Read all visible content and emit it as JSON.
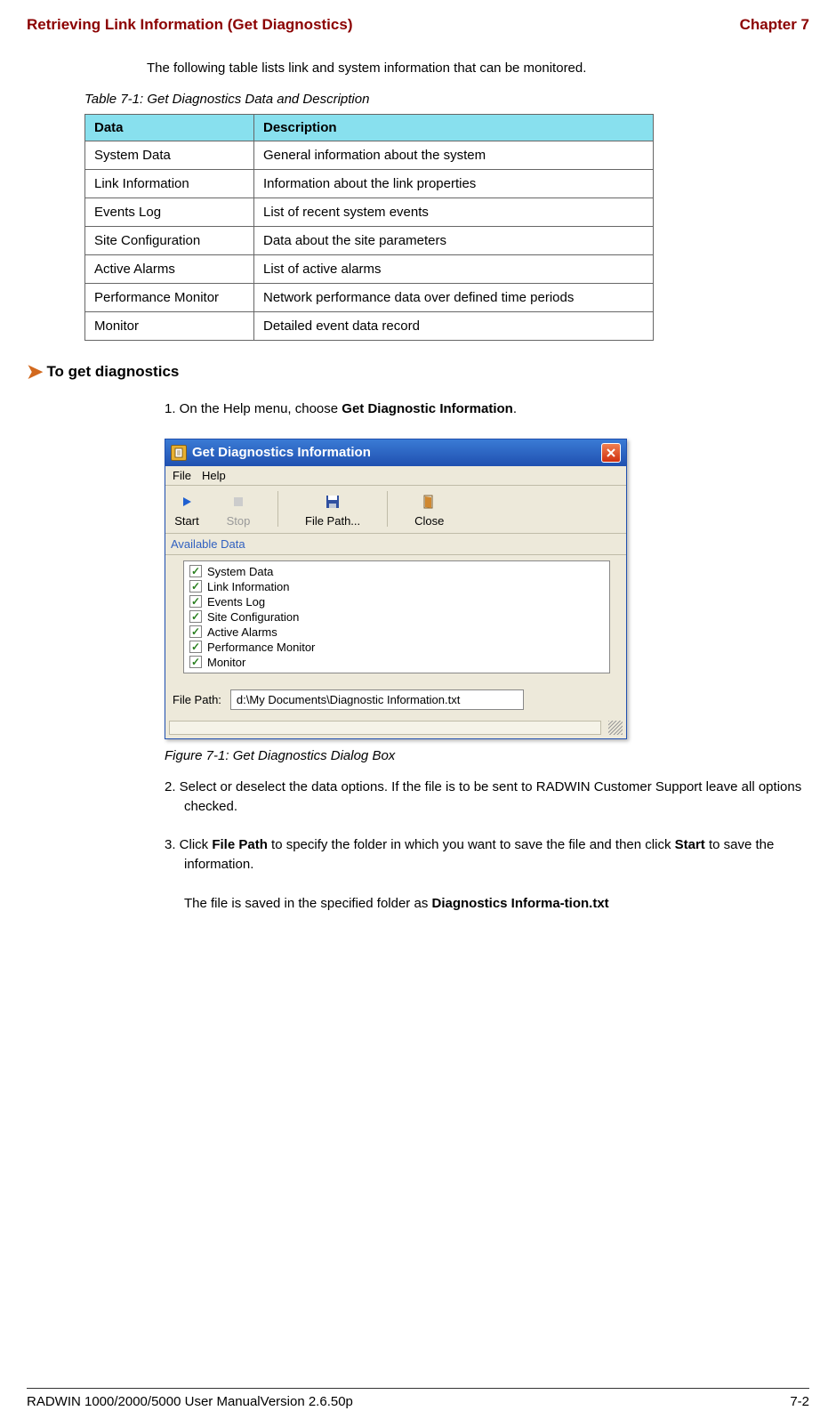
{
  "header": {
    "left": "Retrieving Link Information (Get Diagnostics)",
    "right": "Chapter 7"
  },
  "intro": "The following table lists link and system information that can be monitored.",
  "table": {
    "caption": "Table 7-1: Get Diagnostics Data and Description",
    "header_data": "Data",
    "header_desc": "Description",
    "rows": [
      {
        "data": "System Data",
        "desc": "General information about the system"
      },
      {
        "data": "Link Information",
        "desc": "Information about the link properties"
      },
      {
        "data": "Events Log",
        "desc": "List of recent system events"
      },
      {
        "data": "Site Configuration",
        "desc": "Data about the site parameters"
      },
      {
        "data": "Active Alarms",
        "desc": "List of active alarms"
      },
      {
        "data": "Performance Monitor",
        "desc": "Network performance data over defined time periods"
      },
      {
        "data": "Monitor",
        "desc": "Detailed event data record"
      }
    ]
  },
  "section_title": "To get diagnostics",
  "step1_prefix": "1. On the Help menu, choose ",
  "step1_bold": "Get Diagnostic Information",
  "step1_suffix": ".",
  "dialog": {
    "title": "Get Diagnostics Information",
    "menu": {
      "file": "File",
      "help": "Help"
    },
    "toolbar": {
      "start": "Start",
      "stop": "Stop",
      "filepath": "File Path...",
      "close": "Close"
    },
    "available_label": "Available Data",
    "items": [
      "System Data",
      "Link Information",
      "Events Log",
      "Site Configuration",
      "Active Alarms",
      "Performance Monitor",
      "Monitor"
    ],
    "filepath_label": "File Path:",
    "filepath_value": "d:\\My Documents\\Diagnostic Information.txt"
  },
  "figure_caption": "Figure 7-1: Get Diagnostics Dialog Box",
  "step2": "2. Select or deselect the data options. If the file is to be sent to RADWIN Customer Support leave all options checked.",
  "step3_p1": "3. Click ",
  "step3_b1": "File Path",
  "step3_p2": " to specify the folder in which you want to save the file and then click ",
  "step3_b2": "Start",
  "step3_p3": " to save the information.",
  "step3_after_p1": "The file is saved in the specified folder as ",
  "step3_after_b1": "Diagnostics Informa-tion.txt",
  "footer": {
    "left": "RADWIN 1000/2000/5000 User ManualVersion  2.6.50p",
    "right": "7-2"
  }
}
